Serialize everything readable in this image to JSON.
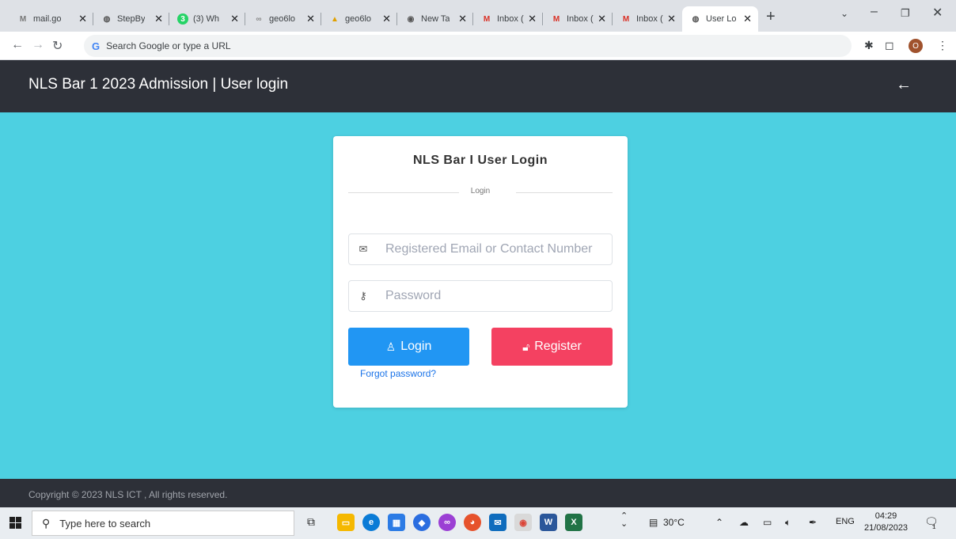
{
  "browser": {
    "tabs": [
      {
        "title": "mail.go",
        "icon": "gmail-icon"
      },
      {
        "title": "StepBy",
        "icon": "globe-icon"
      },
      {
        "title": "(3) Wh",
        "icon": "whatsapp-icon"
      },
      {
        "title": "geo6lo",
        "icon": "link-icon"
      },
      {
        "title": "geo6lo",
        "icon": "doc-icon"
      },
      {
        "title": "New Ta",
        "icon": "chrome-icon"
      },
      {
        "title": "Inbox (",
        "icon": "gmail-icon"
      },
      {
        "title": "Inbox (",
        "icon": "gmail-icon"
      },
      {
        "title": "Inbox (",
        "icon": "gmail-icon"
      },
      {
        "title": "User Lo",
        "icon": "globe-icon",
        "active": true
      }
    ],
    "address_placeholder": "Search Google or type a URL",
    "profile_initial": "O"
  },
  "header": {
    "title": "NLS Bar 1 2023 Admission | User login",
    "back_icon": "arrow-left-icon"
  },
  "login_card": {
    "title": "NLS Bar I User Login",
    "divider_label": "Login",
    "email_placeholder": "Registered Email or Contact Number",
    "password_placeholder": "Password",
    "login_label": "Login",
    "register_label": "Register",
    "forgot_label": "Forgot password?"
  },
  "footer": {
    "copyright": "Copyright © 2023 NLS ICT , All rights reserved."
  },
  "taskbar": {
    "search_placeholder": "Type here to search",
    "weather": "30°C",
    "language": "ENG",
    "time": "04:29",
    "date": "21/08/2023",
    "notification_count": "1"
  },
  "colors": {
    "page_bg": "#4dd0e1",
    "header_bg": "#2d3038",
    "login_btn": "#2196f3",
    "register_btn": "#f44161"
  }
}
